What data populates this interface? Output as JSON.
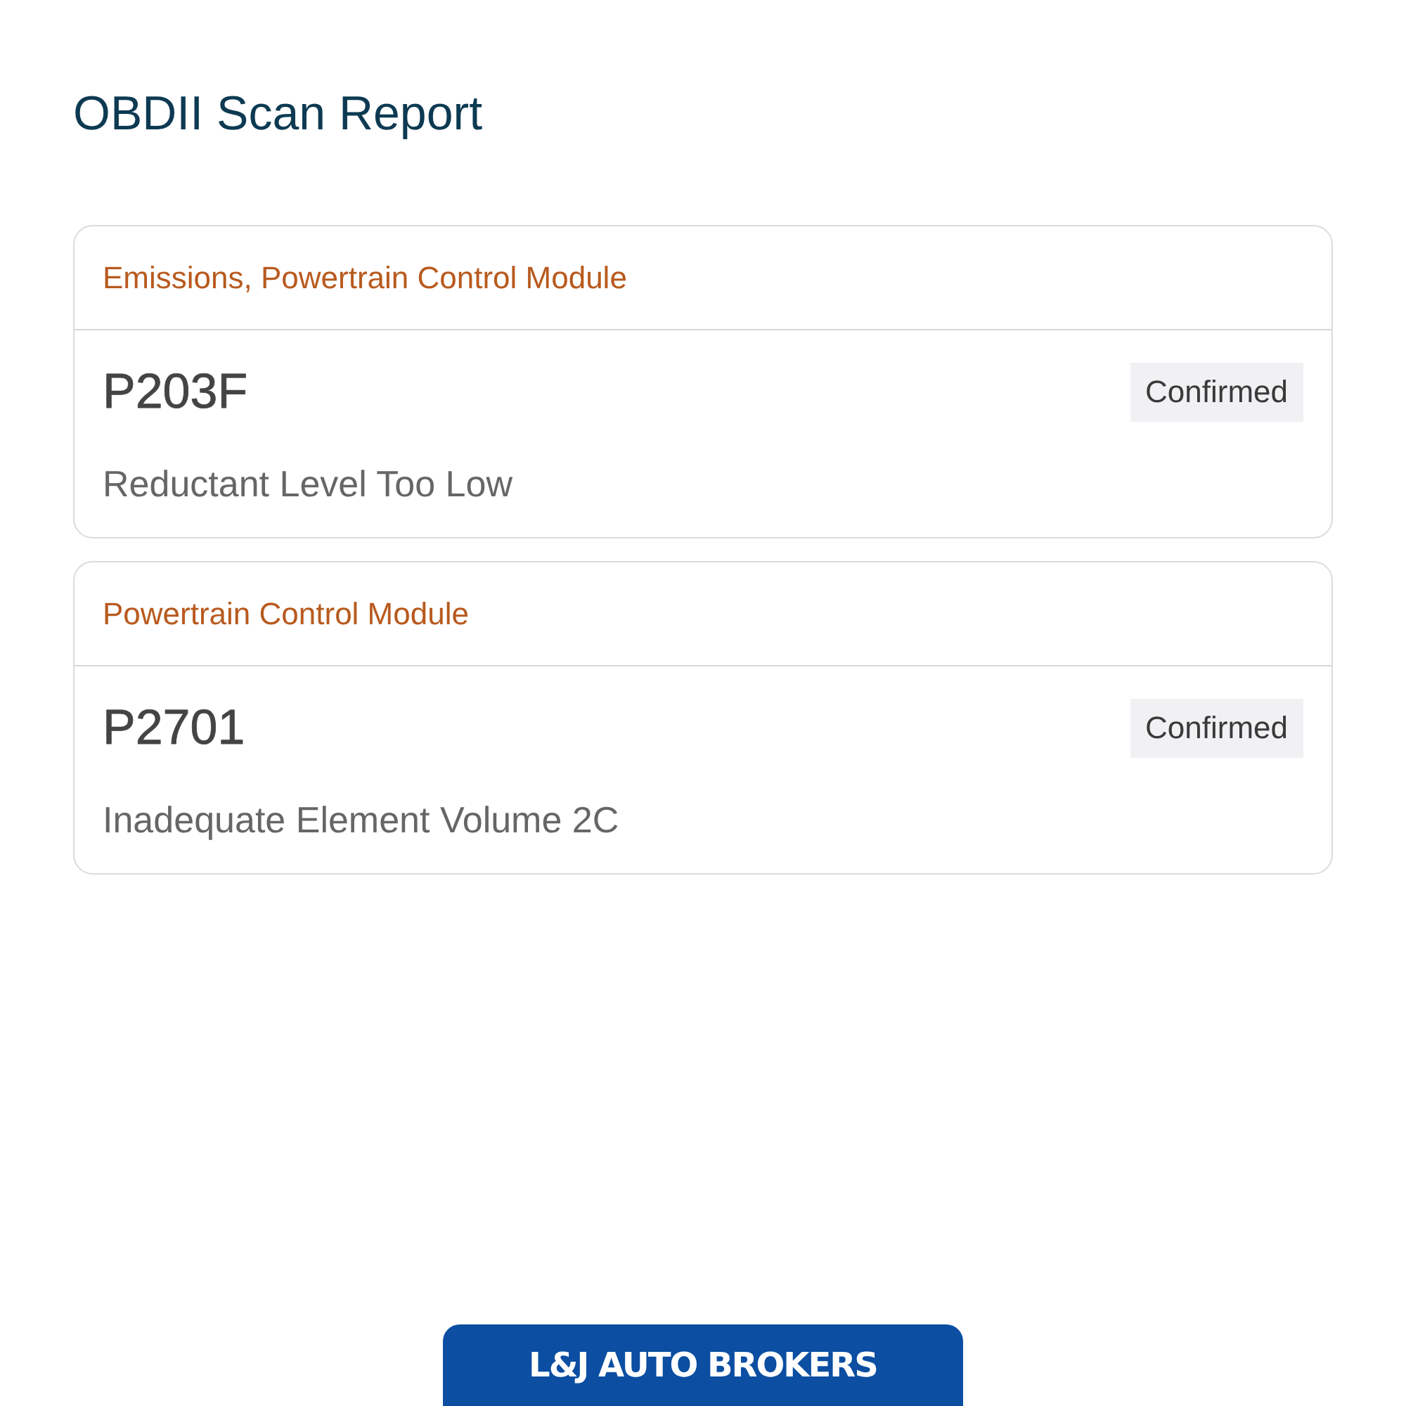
{
  "title": "OBDII Scan Report",
  "cards": [
    {
      "module": "Emissions, Powertrain Control Module",
      "code": "P203F",
      "status": "Confirmed",
      "description": "Reductant Level Too Low"
    },
    {
      "module": "Powertrain Control Module",
      "code": "P2701",
      "status": "Confirmed",
      "description": "Inadequate Element Volume 2C"
    }
  ],
  "footer": {
    "logo": "L&J AUTO BROKERS"
  }
}
